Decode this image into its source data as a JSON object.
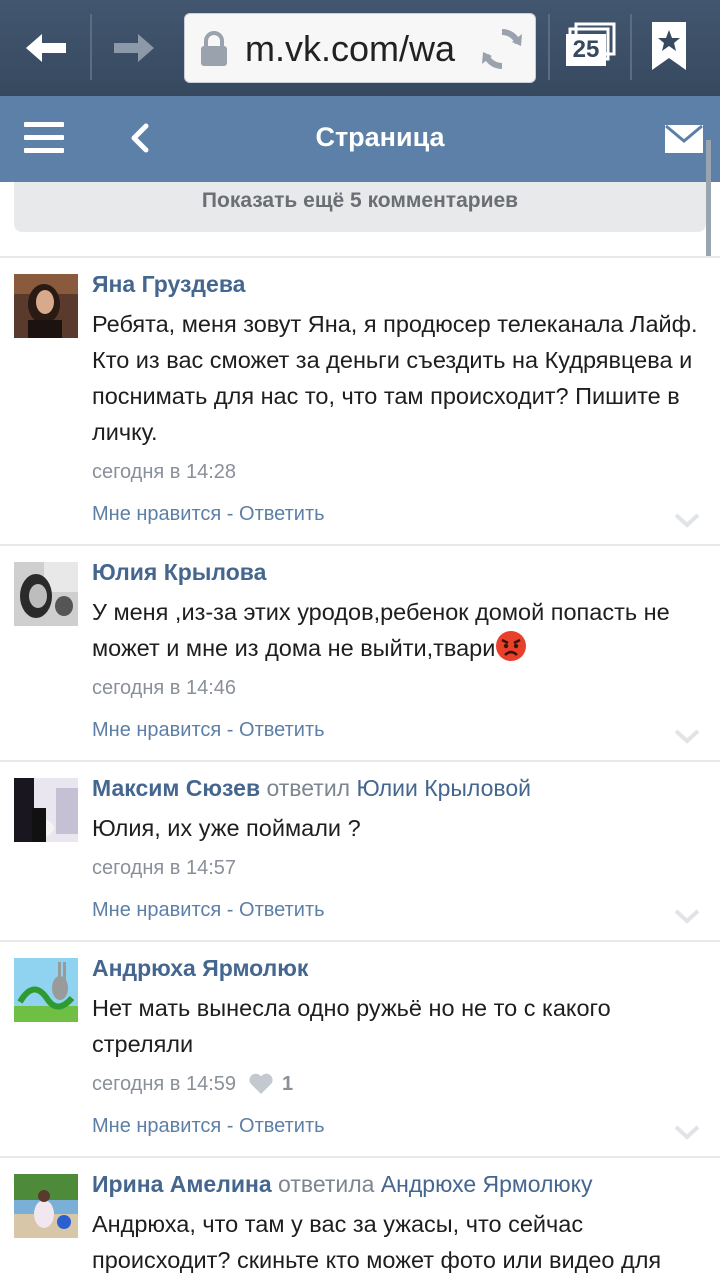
{
  "browser": {
    "url": "m.vk.com/wa",
    "tab_count": "25"
  },
  "header": {
    "title": "Страница"
  },
  "show_more": {
    "label": "Показать ещё 5 комментариев"
  },
  "actions": {
    "like": "Мне нравится",
    "separator": " - ",
    "reply": "Ответить"
  },
  "comments": [
    {
      "author": "Яна Груздева",
      "text": "Ребята, меня зовут Яна, я продюсер телеканала Лайф. Кто из вас сможет за деньги съездить на Кудрявцева и поснимать для нас то, что там происходит? Пишите в личку.",
      "time": "сегодня в 14:28"
    },
    {
      "author": "Юлия Крылова",
      "text": "У меня ,из-за этих уродов,ребенок домой попасть не может и мне из дома не выйти,твари",
      "emoji": "angry-face-emoji",
      "time": "сегодня в 14:46"
    },
    {
      "author": "Максим Сюзев",
      "replied_verb": "ответил",
      "reply_to": "Юлии Крыловой",
      "text": "Юлия, их уже поймали ?",
      "time": "сегодня в 14:57"
    },
    {
      "author": "Андрюха Ярмолюк",
      "text": "Нет мать вынесла одно ружьё но не то с какого стреляли",
      "time": "сегодня в 14:59",
      "likes": "1"
    },
    {
      "author": "Ирина Амелина",
      "replied_verb": "ответила",
      "reply_to": "Андрюхе Ярмолюку",
      "text": "Андрюха, что там у вас за ужасы, что сейчас происходит? скиньте кто может фото или видео для"
    }
  ],
  "colors": {
    "browser_bar": "#3d4f66",
    "vk_header": "#5d80a8",
    "author_link": "#44668f",
    "action_link": "#5d7fa6",
    "meta_gray": "#8a9099"
  }
}
